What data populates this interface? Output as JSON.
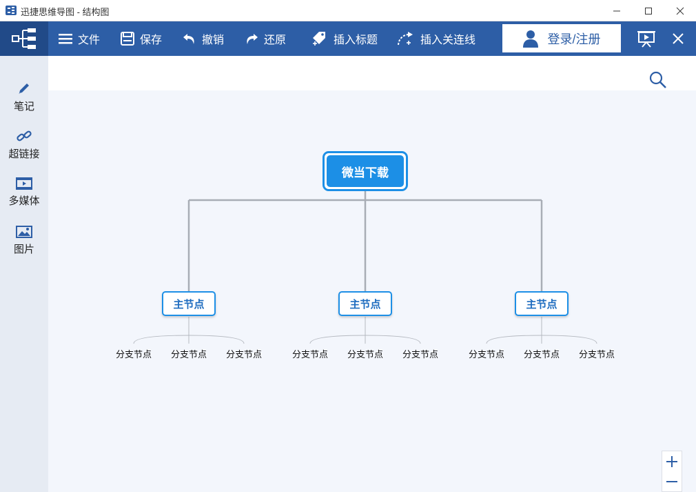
{
  "window": {
    "title": "迅捷思维导图 - 结构图"
  },
  "toolbar": {
    "file_label": "文件",
    "save_label": "保存",
    "undo_label": "撤销",
    "redo_label": "还原",
    "insert_title_label": "插入标题",
    "insert_link_label": "插入关连线",
    "login_label": "登录/注册"
  },
  "sidebar": {
    "items": [
      {
        "label": "笔记",
        "icon": "pen-icon"
      },
      {
        "label": "超链接",
        "icon": "link-icon"
      },
      {
        "label": "多媒体",
        "icon": "media-icon"
      },
      {
        "label": "图片",
        "icon": "image-icon"
      }
    ]
  },
  "mindmap": {
    "root": "微当下载",
    "main_nodes": [
      {
        "label": "主节点",
        "children": [
          "分支节点",
          "分支节点",
          "分支节点"
        ]
      },
      {
        "label": "主节点",
        "children": [
          "分支节点",
          "分支节点",
          "分支节点"
        ]
      },
      {
        "label": "主节点",
        "children": [
          "分支节点",
          "分支节点",
          "分支节点"
        ]
      }
    ]
  },
  "colors": {
    "toolbar": "#2d5ea6",
    "node_accent": "#1c8fe6",
    "connector": "#a8adb5"
  }
}
